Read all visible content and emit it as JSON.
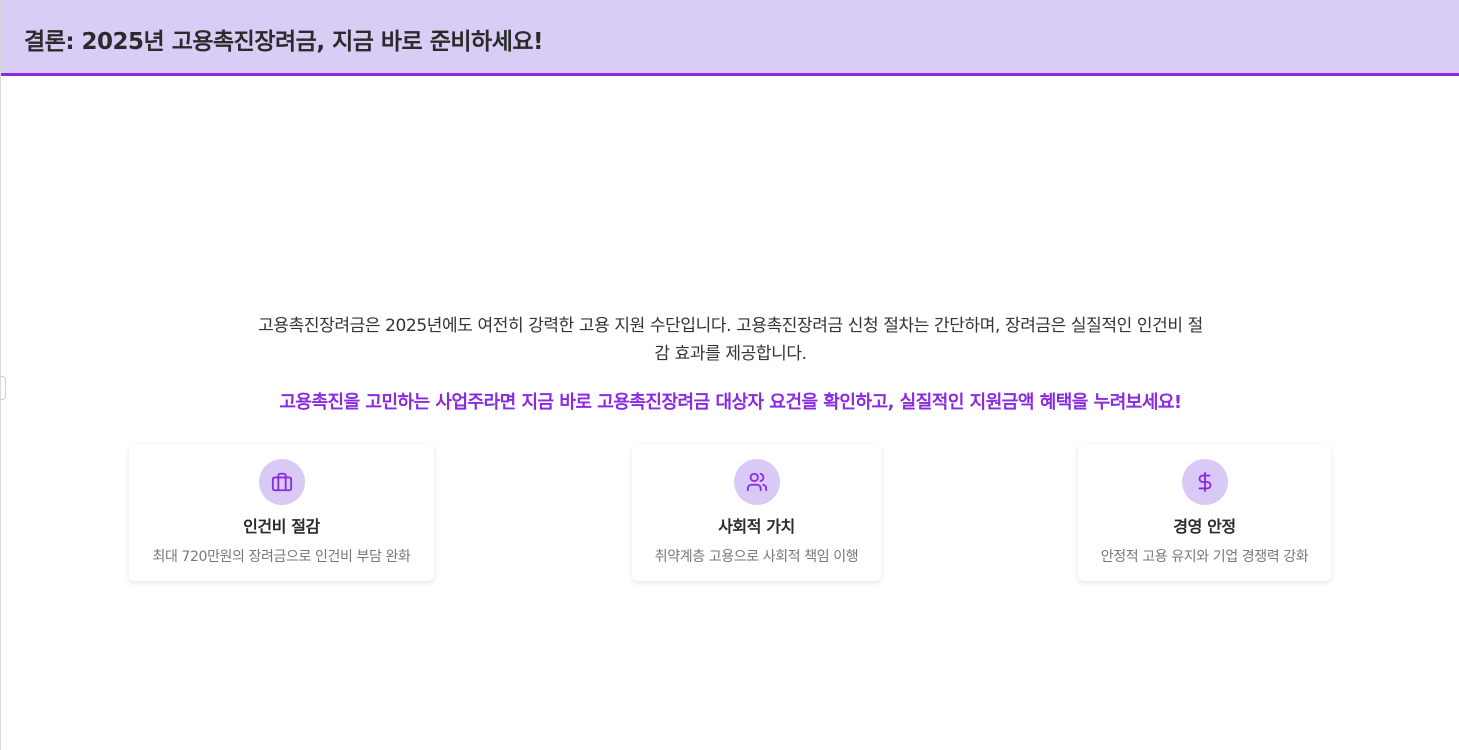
{
  "header": {
    "title": "결론: 2025년 고용촉진장려금, 지금 바로 준비하세요!"
  },
  "summary": {
    "line1": "고용촉진장려금은 2025년에도 여전히 강력한 고용 지원 수단입니다. 고용촉진장려금 신청 절차는 간단하며, 장려금은 실질적인 인건비 절",
    "line2": "감 효과를 제공합니다."
  },
  "cta": {
    "text": "고용촉진을 고민하는 사업주라면 지금 바로 고용촉진장려금 대상자 요건을 확인하고, 실질적인 지원금액 혜택을 누려보세요!"
  },
  "cards": [
    {
      "icon": "briefcase-icon",
      "title": "인건비 절감",
      "description": "최대 720만원의 장려금으로 인건비 부담 완화"
    },
    {
      "icon": "users-icon",
      "title": "사회적 가치",
      "description": "취약계층 고용으로 사회적 책임 이행"
    },
    {
      "icon": "dollar-icon",
      "title": "경영 안정",
      "description": "안정적 고용 유지와 기업 경쟁력 강화"
    }
  ],
  "colors": {
    "header_bg": "#d9cdf6",
    "accent": "#8a2be2",
    "icon_circle": "#d9c9f7"
  }
}
